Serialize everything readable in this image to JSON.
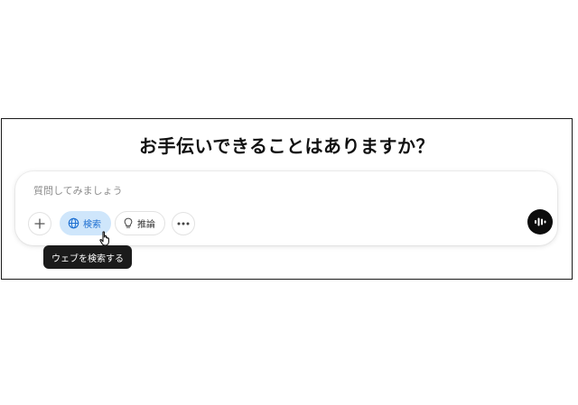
{
  "heading": "お手伝いできることはありますか？",
  "composer": {
    "placeholder": "質問してみましょう",
    "search_label": "検索",
    "reason_label": "推論",
    "tooltip": "ウェブを検索する"
  },
  "colors": {
    "search_active_bg": "#cfe6fb",
    "search_active_fg": "#1d6fd1",
    "voice_bg": "#0d0d0d"
  },
  "icons": [
    "plus-icon",
    "globe-icon",
    "lightbulb-icon",
    "ellipsis-icon",
    "voice-waveform-icon",
    "hand-pointer-cursor-icon"
  ]
}
